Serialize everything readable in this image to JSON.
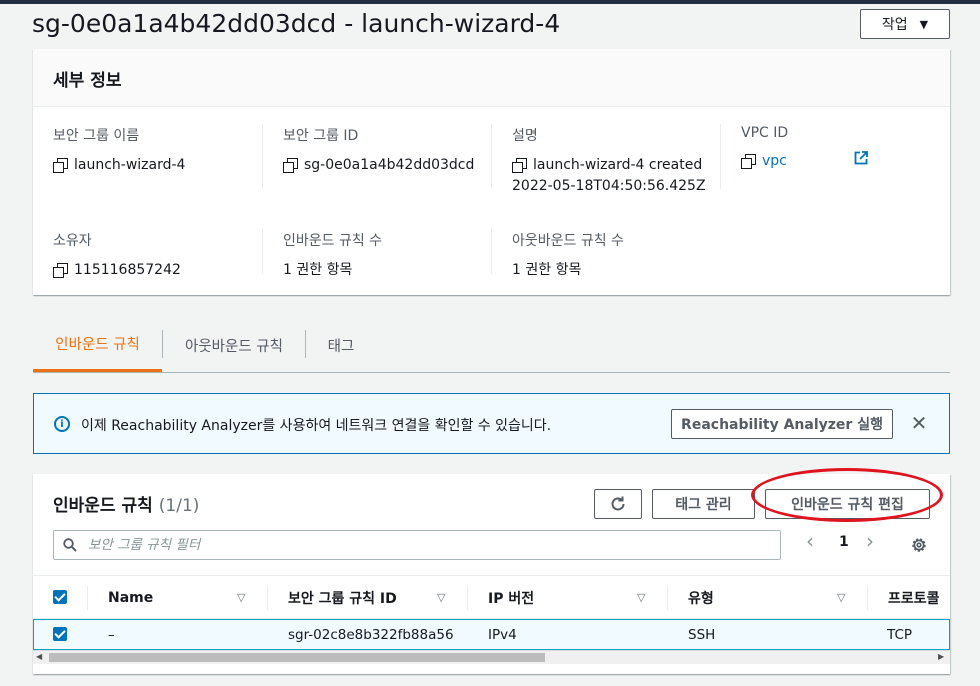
{
  "page": {
    "title": "sg-0e0a1a4b42dd03dcd - launch-wizard-4",
    "action_button": "작업"
  },
  "details": {
    "heading": "세부 정보",
    "fields": [
      {
        "label": "보안 그룹 이름",
        "value": "launch-wizard-4"
      },
      {
        "label": "보안 그룹 ID",
        "value": "sg-0e0a1a4b42dd03dcd"
      },
      {
        "label": "설명",
        "value_line1": "launch-wizard-4 created",
        "value_line2": "2022-05-18T04:50:56.425Z"
      },
      {
        "label": "VPC ID",
        "value": "vpc"
      },
      {
        "label": "소유자",
        "value": "115116857242"
      },
      {
        "label": "인바운드 규칙 수",
        "value": "1 권한 항목"
      },
      {
        "label": "아웃바운드 규칙 수",
        "value": "1 권한 항목"
      }
    ]
  },
  "tabs": [
    "인바운드 규칙",
    "아웃바운드 규칙",
    "태그"
  ],
  "info_banner": {
    "text": "이제 Reachability Analyzer를 사용하여 네트워크 연결을 확인할 수 있습니다.",
    "button": "Reachability Analyzer 실행"
  },
  "rules_panel": {
    "title": "인바운드 규칙",
    "count": "(1/1)",
    "manage_tags": "태그 관리",
    "edit_rules": "인바운드 규칙 편집",
    "search_placeholder": "보안 그룹 규칙 필터",
    "page_number": "1",
    "columns": [
      "Name",
      "보안 그룹 규칙 ID",
      "IP 버전",
      "유형",
      "프로토콜"
    ],
    "rows": [
      {
        "name": "–",
        "rule_id": "sgr-02c8e8b322fb88a56",
        "ip_version": "IPv4",
        "type": "SSH",
        "protocol": "TCP"
      }
    ]
  },
  "colors": {
    "accent_orange": "#ec7211",
    "link_blue": "#0073bb",
    "highlight_red": "#e0141e"
  }
}
